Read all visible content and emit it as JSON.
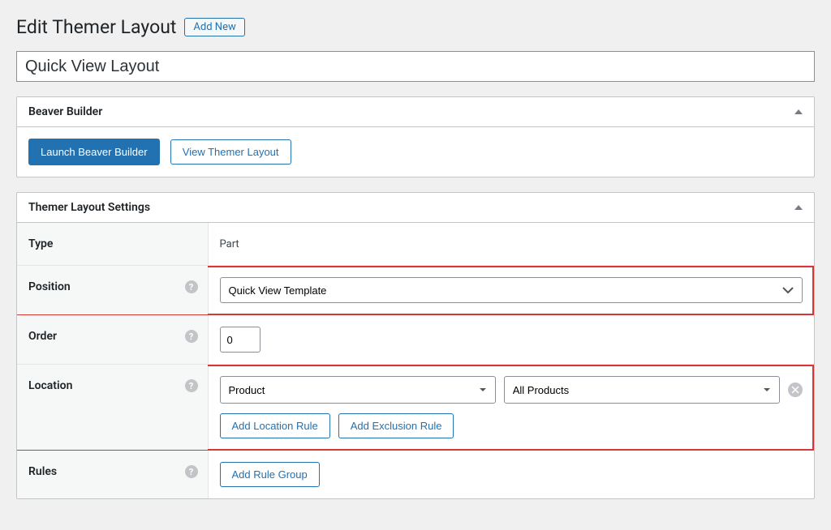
{
  "header": {
    "title": "Edit Themer Layout",
    "add_new_label": "Add New"
  },
  "title_input_value": "Quick View Layout",
  "beaver_builder": {
    "box_title": "Beaver Builder",
    "launch_label": "Launch Beaver Builder",
    "view_label": "View Themer Layout"
  },
  "settings": {
    "box_title": "Themer Layout Settings",
    "rows": {
      "type": {
        "label": "Type",
        "value": "Part"
      },
      "position": {
        "label": "Position",
        "select_value": "Quick View Template"
      },
      "order": {
        "label": "Order",
        "value": "0"
      },
      "location": {
        "label": "Location",
        "select1": "Product",
        "select2": "All Products",
        "add_location_label": "Add Location Rule",
        "add_exclusion_label": "Add Exclusion Rule"
      },
      "rules": {
        "label": "Rules",
        "add_group_label": "Add Rule Group"
      }
    }
  }
}
